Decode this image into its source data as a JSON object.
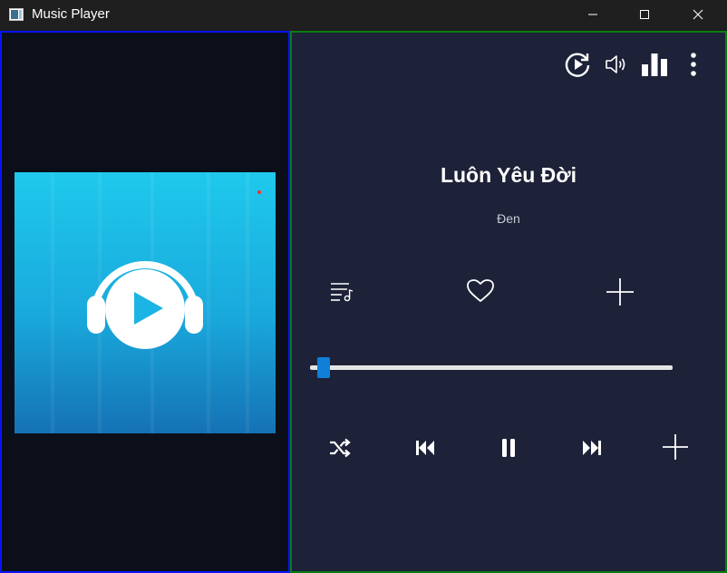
{
  "window": {
    "title": "Music Player",
    "controls": [
      "minimize",
      "maximize",
      "close"
    ]
  },
  "album_art": {
    "icon": "headphones-play-icon",
    "colors": {
      "top": "#1fc9ec",
      "bottom": "#1572b4"
    }
  },
  "player": {
    "song_title": "Luôn Yêu Đời",
    "artist": "Đen",
    "progress": 0.02,
    "top_icons": [
      "replay-icon",
      "volume-icon",
      "equalizer-icon",
      "more-vertical-icon"
    ],
    "action_icons": [
      "playlist-icon",
      "heart-icon",
      "add-icon"
    ],
    "transport_icons": [
      "shuffle-icon",
      "previous-icon",
      "pause-icon",
      "next-icon",
      "add-icon"
    ]
  },
  "colors": {
    "left_bg": "#0a0f1a",
    "right_bg": "#1d2238",
    "accent": "#0f7fd8",
    "left_border": "#0a12ff",
    "right_border": "#0a7d12"
  }
}
